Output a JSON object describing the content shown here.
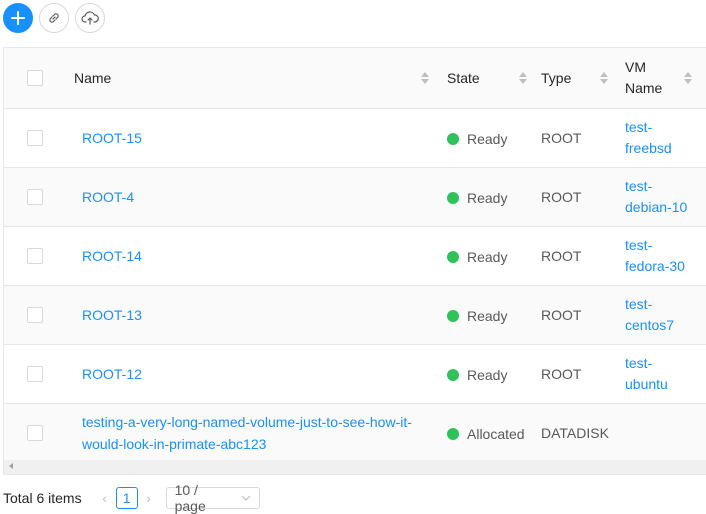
{
  "toolbar": {
    "add_icon": "plus-icon",
    "link_icon": "link-icon",
    "upload_icon": "cloud-upload-icon"
  },
  "table": {
    "headers": {
      "name": "Name",
      "state": "State",
      "type": "Type",
      "vm_name_line1": "VM",
      "vm_name_line2": "Name"
    },
    "rows": [
      {
        "name": "ROOT-15",
        "state": "Ready",
        "type": "ROOT",
        "vm_line1": "test-",
        "vm_line2": "freebsd"
      },
      {
        "name": "ROOT-4",
        "state": "Ready",
        "type": "ROOT",
        "vm_line1": "test-",
        "vm_line2": "debian-10"
      },
      {
        "name": "ROOT-14",
        "state": "Ready",
        "type": "ROOT",
        "vm_line1": "test-",
        "vm_line2": "fedora-30"
      },
      {
        "name": "ROOT-13",
        "state": "Ready",
        "type": "ROOT",
        "vm_line1": "test-",
        "vm_line2": "centos7"
      },
      {
        "name": "ROOT-12",
        "state": "Ready",
        "type": "ROOT",
        "vm_line1": "test-",
        "vm_line2": "ubuntu"
      },
      {
        "name_line1": "testing-a-very-long-named-volume-just-to-see-how-it-",
        "name_line2": "would-look-in-primate-abc123",
        "state": "Allocated",
        "type": "DATADISK"
      }
    ],
    "status_color": "#2fc25b",
    "link_color": "#1890ff"
  },
  "pagination": {
    "total": "Total 6 items",
    "current_page": "1",
    "page_size": "10 / page"
  }
}
